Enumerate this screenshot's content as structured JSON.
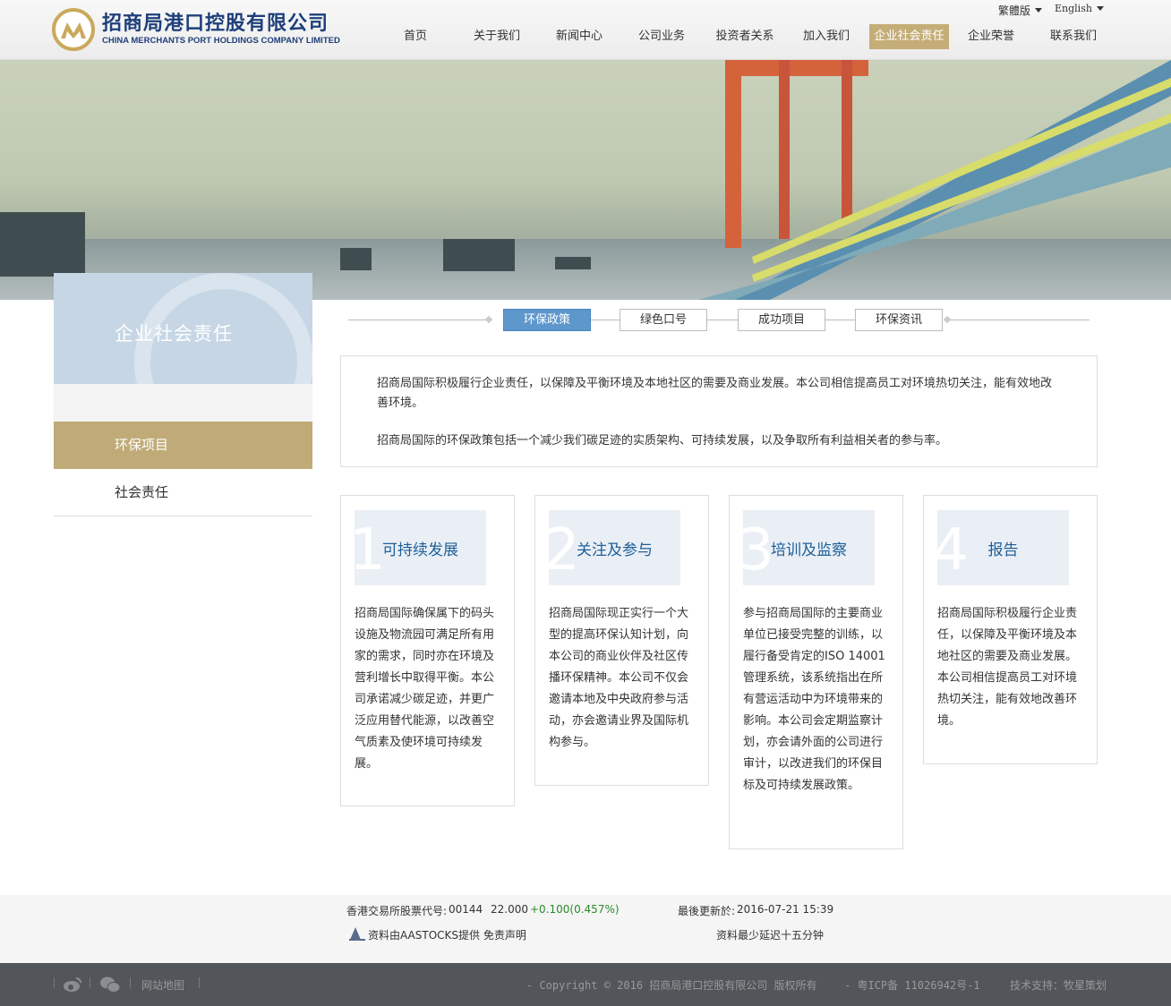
{
  "header": {
    "logo_cn": "招商局港口控股有限公司",
    "logo_en": "CHINA MERCHANTS PORT HOLDINGS COMPANY LIMITED",
    "lang_traditional": "繁體版",
    "lang_english": "English",
    "nav": [
      "首页",
      "关于我们",
      "新闻中心",
      "公司业务",
      "投资者关系",
      "加入我们",
      "企业社会责任",
      "企业荣誉",
      "联系我们"
    ],
    "active_nav": "企业社会责任"
  },
  "sidebar": {
    "title": "企业社会责任",
    "items": [
      "环保项目",
      "社会责任"
    ],
    "active": "环保项目"
  },
  "tabs": {
    "items": [
      "环保政策",
      "绿色口号",
      "成功项目",
      "环保资讯"
    ],
    "active": "环保政策"
  },
  "intro": {
    "p1": "招商局国际积极履行企业责任，以保障及平衡环境及本地社区的需要及商业发展。本公司相信提高员工对环境热切关注，能有效地改善环境。",
    "p2": "招商局国际的环保政策包括一个减少我们碳足迹的实质架构、可持续发展，以及争取所有利益相关者的参与率。"
  },
  "cards": [
    {
      "num": "1",
      "title": "可持续发展",
      "body": "招商局国际确保属下的码头设施及物流园可满足所有用家的需求，同时亦在环境及营利增长中取得平衡。本公司承诺减少碳足迹，并更广泛应用替代能源，以改善空气质素及使环境可持续发展。"
    },
    {
      "num": "2",
      "title": "关注及参与",
      "body": "招商局国际现正实行一个大型的提高环保认知计划，向本公司的商业伙伴及社区传播环保精神。本公司不仅会邀请本地及中央政府参与活动，亦会邀请业界及国际机构参与。"
    },
    {
      "num": "3",
      "title": "培训及监察",
      "body": "参与招商局国际的主要商业单位已接受完整的训练，以履行备受肯定的ISO 14001管理系统，该系统指出在所有营运活动中为环境带来的影响。本公司会定期监察计划，亦会请外面的公司进行审计，以改进我们的环保目标及可持续发展政策。"
    },
    {
      "num": "4",
      "title": "报告",
      "body": "招商局国际积极履行企业责任，以保障及平衡环境及本地社区的需要及商业发展。本公司相信提高员工对环境热切关注，能有效地改善环境。"
    }
  ],
  "stock": {
    "label": "香港交易所股票代号:",
    "code": "00144",
    "price": "22.000",
    "change": "+0.100(0.457%)",
    "updated_label": "最後更新於:",
    "updated": "2016-07-21 15:39",
    "source": "资料由AASTOCKS提供 免责声明",
    "delay": "资料最少延迟十五分钟"
  },
  "footer": {
    "sitemap": "网站地图",
    "copyright": "- Copyright © 2016 招商局港口控股有限公司 版权所有",
    "icp": "- 粤ICP备 11026942号-1",
    "support": "技术支持：牧星策划"
  },
  "colors": {
    "accent_gold": "#c0ab78",
    "tab_blue": "#5d97cc",
    "stock_green": "#2a8a2a",
    "footer_bg": "#52555a"
  }
}
